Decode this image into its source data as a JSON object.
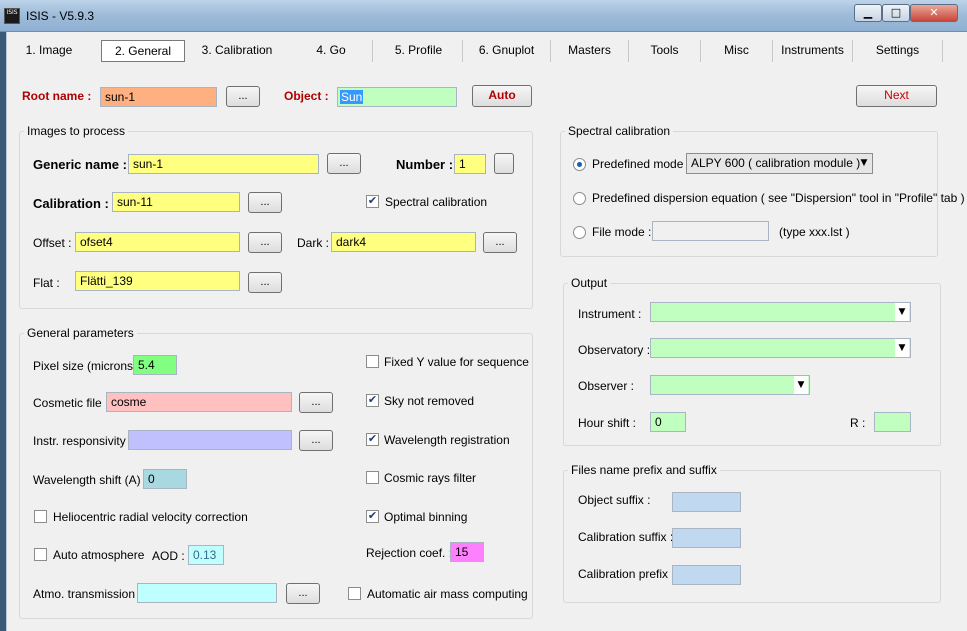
{
  "window": {
    "title": "ISIS - V5.9.3",
    "icon_text": "ISIS"
  },
  "tabs": [
    {
      "label": "1. Image"
    },
    {
      "label": "2. General"
    },
    {
      "label": "3. Calibration"
    },
    {
      "label": "4. Go"
    },
    {
      "label": "5. Profile"
    },
    {
      "label": "6. Gnuplot"
    },
    {
      "label": "Masters"
    },
    {
      "label": "Tools"
    },
    {
      "label": "Misc"
    },
    {
      "label": "Instruments"
    },
    {
      "label": "Settings"
    }
  ],
  "active_tab": "2. General",
  "top_row": {
    "root_label": "Root name :",
    "root_value": "sun-1",
    "object_label": "Object :",
    "object_value": "Sun",
    "auto_label": "Auto",
    "next_label": "Next",
    "browse": "..."
  },
  "images": {
    "title": "Images to process",
    "generic_label": "Generic name :",
    "generic_value": "sun-1",
    "number_label": "Number :",
    "number_value": "1",
    "calibration_label": "Calibration :",
    "calibration_value": "sun-11",
    "spectral_cal_label": "Spectral calibration",
    "spectral_cal_checked": true,
    "offset_label": "Offset :",
    "offset_value": "ofset4",
    "dark_label": "Dark :",
    "dark_value": "dark4",
    "flat_label": "Flat :",
    "flat_value": "Flätti_139"
  },
  "general": {
    "title": "General parameters",
    "pixel_label": "Pixel size (microns) :",
    "pixel_value": "5.4",
    "cosmetic_label": "Cosmetic file :",
    "cosmetic_value": "cosme",
    "instr_label": "Instr. responsivity :",
    "instr_value": "",
    "wlshift_label": "Wavelength shift (A) :",
    "wlshift_value": "0",
    "helio_label": "Heliocentric radial velocity correction",
    "auto_atmo_label": "Auto atmosphere",
    "aod_label": "AOD :",
    "aod_value": "0.13",
    "atmo_label": "Atmo. transmission :",
    "atmo_value": "",
    "fixedy_label": "Fixed Y value for sequence",
    "sky_label": "Sky not removed",
    "wlreg_label": "Wavelength registration",
    "cosmic_label": "Cosmic rays filter",
    "optimal_label": "Optimal binning",
    "rejection_label": "Rejection coef. :",
    "rejection_value": "15",
    "airmass_label": "Automatic air mass computing",
    "checks": {
      "fixedy": false,
      "sky": true,
      "wlreg": true,
      "cosmic": false,
      "optimal": true,
      "helio": false,
      "auto_atmo": false,
      "airmass": false
    }
  },
  "spectral": {
    "title": "Spectral calibration",
    "predefined_label": "Predefined mode",
    "predefined_value": "ALPY 600 ( calibration module )",
    "dispersion_label": "Predefined dispersion equation ( see \"Dispersion\" tool in \"Profile\" tab )",
    "file_label": "File mode :",
    "file_value": "",
    "file_hint": "(type xxx.lst )",
    "selected": "predefined"
  },
  "output": {
    "title": "Output",
    "instrument_label": "Instrument :",
    "instrument_value": "",
    "observatory_label": "Observatory :",
    "observatory_value": "",
    "observer_label": "Observer :",
    "observer_value": "",
    "hourshift_label": "Hour shift :",
    "hourshift_value": "0",
    "r_label": "R :",
    "r_value": ""
  },
  "files": {
    "title": "Files name prefix and suffix",
    "object_suffix_label": "Object suffix :",
    "object_suffix_value": "",
    "cal_suffix_label": "Calibration suffix :",
    "cal_suffix_value": "",
    "cal_prefix_label": "Calibration prefix :",
    "cal_prefix_value": ""
  }
}
